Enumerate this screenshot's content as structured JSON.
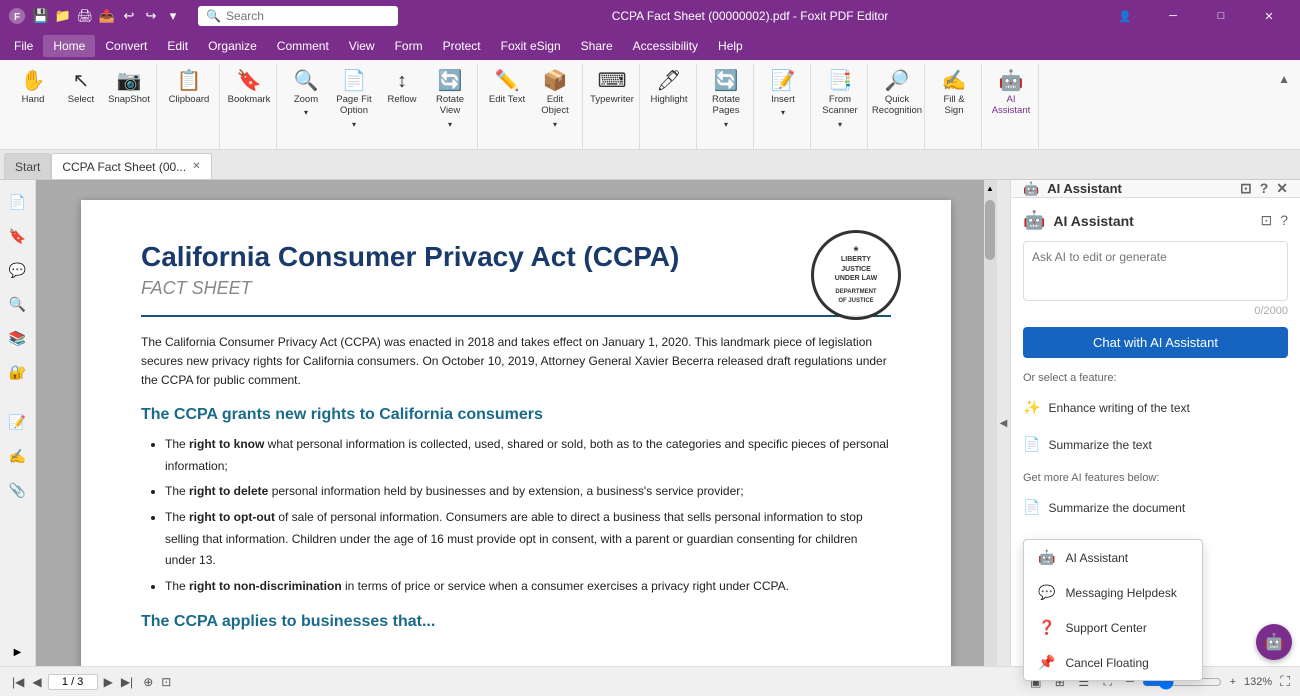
{
  "titlebar": {
    "title": "CCPA Fact Sheet (00000002).pdf - Foxit PDF Editor",
    "search_placeholder": "Search"
  },
  "menubar": {
    "items": [
      "File",
      "Home",
      "Convert",
      "Edit",
      "Organize",
      "Comment",
      "View",
      "Form",
      "Protect",
      "Foxit eSign",
      "Share",
      "Accessibility",
      "Help"
    ]
  },
  "ribbon": {
    "groups": [
      {
        "label": "",
        "buttons": [
          {
            "icon": "✋",
            "label": "Hand"
          },
          {
            "icon": "↖",
            "label": "Select"
          },
          {
            "icon": "📷",
            "label": "SnapShot"
          }
        ]
      },
      {
        "label": "",
        "buttons": [
          {
            "icon": "📋",
            "label": "Clipboard"
          }
        ]
      },
      {
        "label": "",
        "buttons": [
          {
            "icon": "🔖",
            "label": "Bookmark"
          }
        ]
      },
      {
        "label": "",
        "buttons": [
          {
            "icon": "🔍",
            "label": "Zoom"
          },
          {
            "icon": "📄",
            "label": "Page Fit Option"
          },
          {
            "icon": "↕",
            "label": "Reflow"
          },
          {
            "icon": "🔄",
            "label": "Rotate View"
          }
        ]
      },
      {
        "label": "",
        "buttons": [
          {
            "icon": "✏️",
            "label": "Edit Text"
          },
          {
            "icon": "📦",
            "label": "Edit Object"
          }
        ]
      },
      {
        "label": "",
        "buttons": [
          {
            "icon": "⌨",
            "label": "Typewriter"
          }
        ]
      },
      {
        "label": "",
        "buttons": [
          {
            "icon": "🖊",
            "label": "Highlight"
          }
        ]
      },
      {
        "label": "",
        "buttons": [
          {
            "icon": "🔄",
            "label": "Rotate Pages"
          }
        ]
      },
      {
        "label": "",
        "buttons": [
          {
            "icon": "📝",
            "label": "Insert"
          }
        ]
      },
      {
        "label": "",
        "buttons": [
          {
            "icon": "📑",
            "label": "From Scanner"
          }
        ]
      },
      {
        "label": "",
        "buttons": [
          {
            "icon": "🔎",
            "label": "Quick Recognition"
          }
        ]
      },
      {
        "label": "",
        "buttons": [
          {
            "icon": "✍",
            "label": "Fill & Sign"
          }
        ]
      },
      {
        "label": "",
        "buttons": [
          {
            "icon": "🤖",
            "label": "AI Assistant"
          }
        ]
      }
    ]
  },
  "tabs": [
    {
      "label": "Start",
      "active": false
    },
    {
      "label": "CCPA Fact Sheet (00...",
      "active": true,
      "closable": true
    }
  ],
  "document": {
    "title": "California Consumer Privacy Act (CCPA)",
    "subtitle": "FACT SHEET",
    "seal_text": "DEPARTMENT OF JUSTICE",
    "intro_text": "The California Consumer Privacy Act (CCPA) was enacted in 2018 and takes effect on January 1, 2020. This landmark piece of legislation secures new privacy rights for California consumers. On October 10, 2019, Attorney General Xavier Becerra released draft regulations under the CCPA for public comment.",
    "rights_heading": "The CCPA grants new rights to California consumers",
    "rights": [
      {
        "right": "right to know",
        "text": " what personal information is collected, used, shared or sold, both as to the categories and specific pieces of personal information;"
      },
      {
        "right": "right to delete",
        "text": " personal information held by businesses and by extension, a business's service provider;"
      },
      {
        "right": "right to opt-out",
        "text": " of sale of personal information. Consumers are able to direct a business that sells personal information to stop selling that information. Children under the age of 16 must provide opt in consent, with a parent or guardian consenting for children under 13."
      },
      {
        "right": "right to non-discrimination",
        "text": " in terms of price or service when a consumer exercises a privacy right under CCPA."
      }
    ],
    "footer_heading": "The CCPA applies to businesses that..."
  },
  "ai_panel": {
    "header_label": "AI Assistant",
    "assistant_title": "AI Assistant",
    "textarea_placeholder": "Ask AI to edit or generate",
    "char_count": "0/2000",
    "chat_button": "Chat with AI Assistant",
    "select_feature_label": "Or select a feature:",
    "features": [
      {
        "icon": "✨",
        "label": "Enhance writing of the text"
      },
      {
        "icon": "📄",
        "label": "Summarize the text"
      }
    ],
    "more_label": "Get more AI features below:",
    "more_features": [
      {
        "icon": "📄",
        "label": "Summarize the document"
      }
    ],
    "dropdown": {
      "items": [
        {
          "icon": "🤖",
          "label": "AI Assistant"
        },
        {
          "icon": "💬",
          "label": "Messaging Helpdesk"
        },
        {
          "icon": "❓",
          "label": "Support Center"
        },
        {
          "icon": "📌",
          "label": "Cancel Floating"
        }
      ]
    }
  },
  "statusbar": {
    "page_current": "1",
    "page_total": "3",
    "zoom": "132%",
    "view_icons": [
      "🖥",
      "📐",
      "📏"
    ]
  },
  "left_sidebar": {
    "icons": [
      "📄",
      "🔖",
      "💬",
      "🔍",
      "📚",
      "🔐",
      "📝",
      "✍",
      "📂"
    ]
  }
}
